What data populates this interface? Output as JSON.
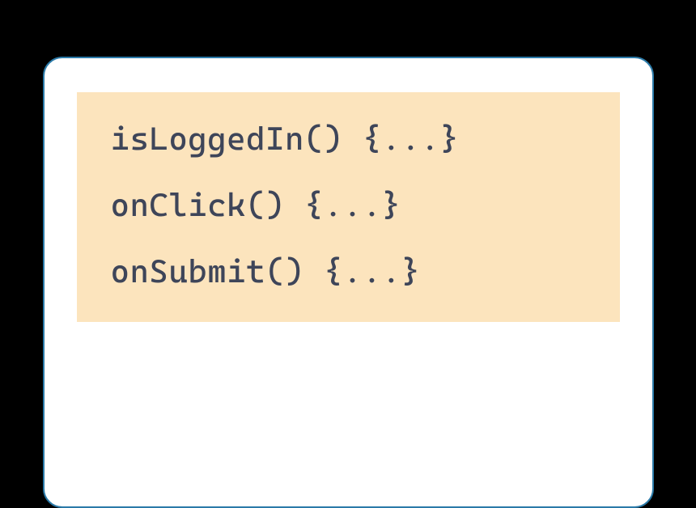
{
  "codeBlock": {
    "lines": [
      "isLoggedIn() {...}",
      "onClick() {...}",
      "onSubmit() {...}"
    ]
  },
  "colors": {
    "cardBorder": "#2b7aa8",
    "codeBackground": "#fce4bd",
    "codeText": "#3e4559"
  }
}
